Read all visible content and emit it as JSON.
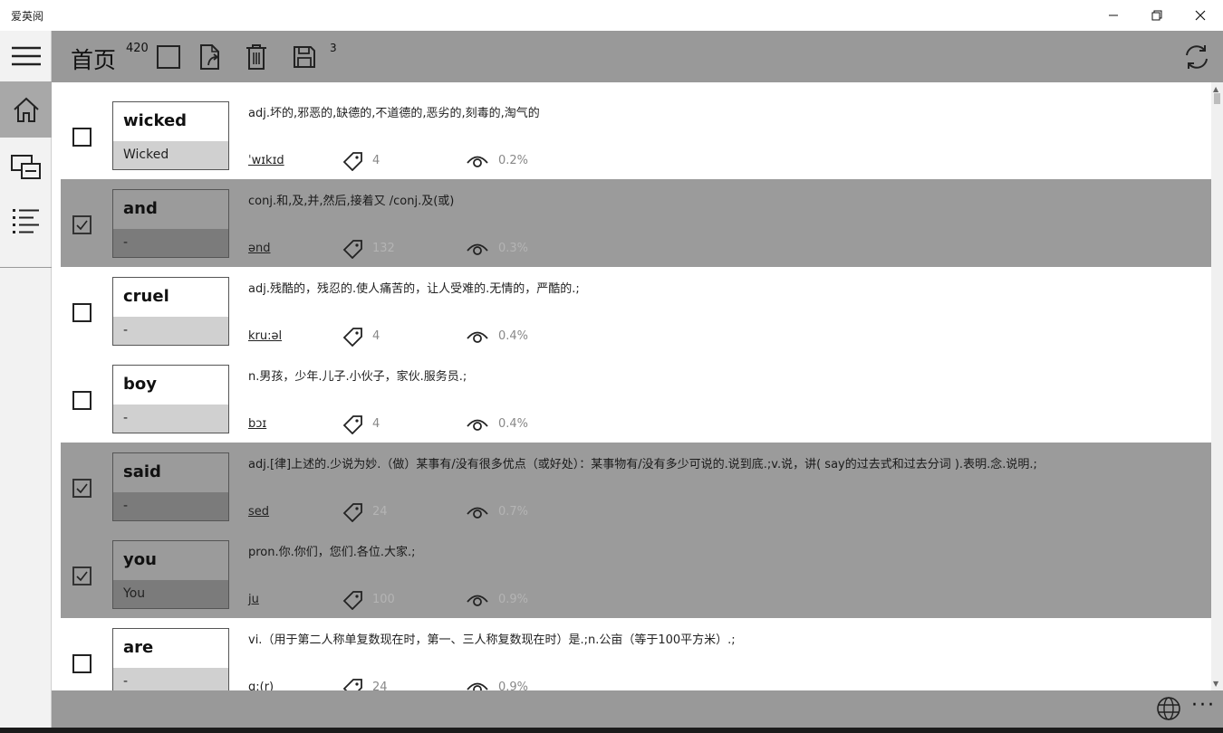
{
  "window": {
    "title": "爱英阅"
  },
  "toolbar": {
    "title": "首页",
    "word_count": "420",
    "saved_count": "3"
  },
  "rows": [
    {
      "word": "wicked",
      "alt": "Wicked",
      "def": "adj.坏的,邪恶的,缺德的,不道德的,恶劣的,刻毒的,淘气的",
      "phonetic": "ˈwɪkɪd",
      "tag": "4",
      "views": "0.2%",
      "selected": false
    },
    {
      "word": "and",
      "alt": "-",
      "def": " conj.和,及,并,然后,接着又 /conj.及(或)",
      "phonetic": "ənd",
      "tag": "132",
      "views": "0.3%",
      "selected": true
    },
    {
      "word": "cruel",
      "alt": "-",
      "def": "adj.残酷的，残忍的.使人痛苦的，让人受难的.无情的，严酷的.;",
      "phonetic": "kru:əl",
      "tag": "4",
      "views": "0.4%",
      "selected": false
    },
    {
      "word": "boy",
      "alt": "-",
      "def": "n.男孩，少年.儿子.小伙子，家伙.服务员.;",
      "phonetic": "bɔɪ",
      "tag": "4",
      "views": "0.4%",
      "selected": false
    },
    {
      "word": "said",
      "alt": "-",
      "def": "adj.[律]上述的.少说为妙.（做）某事有/没有很多优点（或好处）：某事物有/没有多少可说的.说到底.;v.说，讲( say的过去式和过去分词 ).表明.念.说明.;",
      "phonetic": "sed",
      "tag": "24",
      "views": "0.7%",
      "selected": true
    },
    {
      "word": "you",
      "alt": "You",
      "def": "pron.你.你们，您们.各位.大家.;",
      "phonetic": "ju",
      "tag": "100",
      "views": "0.9%",
      "selected": true
    },
    {
      "word": "are",
      "alt": "-",
      "def": "vi.（用于第二人称单复数现在时，第一、三人称复数现在时）是.;n.公亩（等于100平方米）.;",
      "phonetic": "ɑ:(r)",
      "tag": "24",
      "views": "0.9%",
      "selected": false
    }
  ],
  "icons": {
    "sidebar": [
      "hamburger-icon",
      "home-icon",
      "print-layout-icon",
      "list-icon"
    ],
    "toolbar": [
      "select-square-icon",
      "export-file-icon",
      "trash-icon",
      "save-icon",
      "refresh-icon"
    ],
    "row": [
      "tag-icon",
      "eye-icon"
    ],
    "bottom": [
      "globe-icon",
      "more-icon"
    ]
  }
}
